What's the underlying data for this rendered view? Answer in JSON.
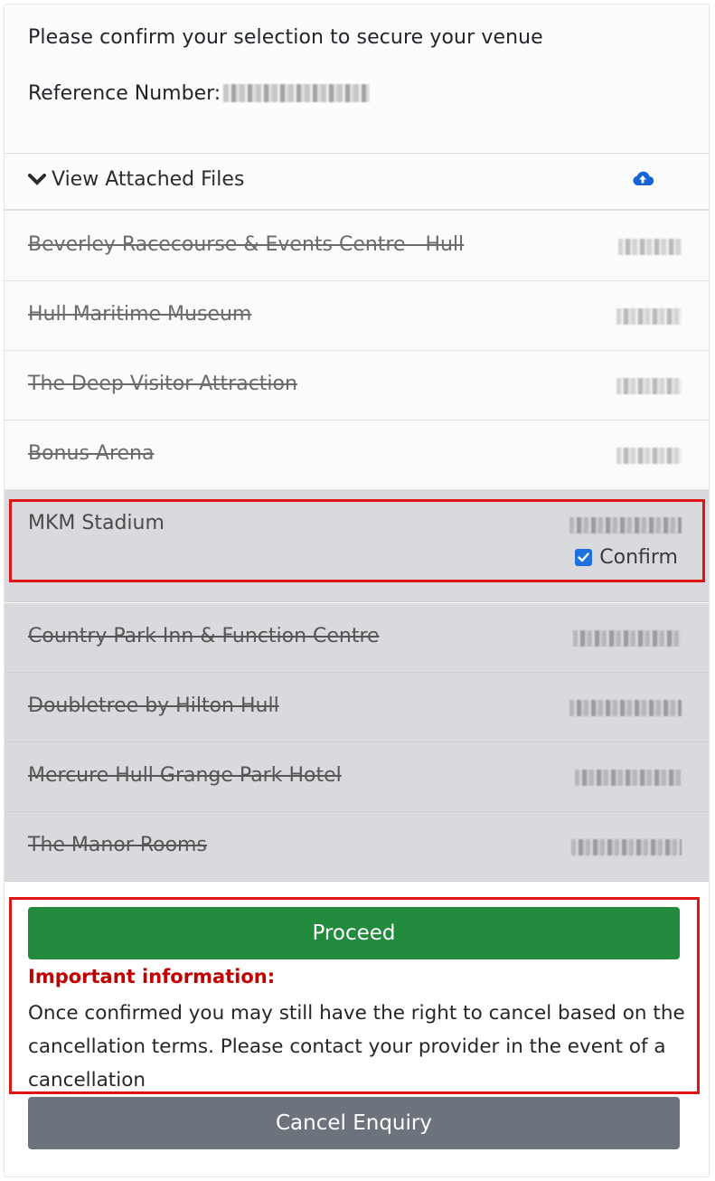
{
  "header": {
    "instruction": "Please confirm your selection to secure your venue",
    "reference_label": "Reference Number:"
  },
  "files": {
    "toggle_label": "View Attached Files",
    "toggle_icon": "chevron-down-icon",
    "upload_icon": "cloud-upload-icon"
  },
  "venues": [
    {
      "name": "Beverley Racecourse & Events Centre - Hull",
      "status": "declined"
    },
    {
      "name": "Hull Maritime Museum",
      "status": "declined"
    },
    {
      "name": "The Deep Visitor Attraction",
      "status": "declined"
    },
    {
      "name": "Bonus Arena",
      "status": "declined"
    },
    {
      "name": "MKM Stadium",
      "status": "selected",
      "confirm_label": "Confirm",
      "confirm_checked": true
    },
    {
      "name": "Country Park Inn & Function Centre",
      "status": "declined"
    },
    {
      "name": "Doubletree by Hilton Hull",
      "status": "declined"
    },
    {
      "name": "Mercure Hull Grange Park Hotel",
      "status": "declined"
    },
    {
      "name": "The Manor Rooms",
      "status": "declined"
    }
  ],
  "actions": {
    "proceed_label": "Proceed",
    "important_title": "Important information:",
    "important_text": "Once confirmed you may still have the right to cancel based on the cancellation terms. Please contact your provider in the event of a cancellation",
    "cancel_label": "Cancel Enquiry"
  },
  "colors": {
    "proceed": "#218a3d",
    "cancel": "#6c737c",
    "highlight": "#e01414",
    "important": "#c00000",
    "checkbox": "#1e6fe0",
    "icon": "#1565d8"
  }
}
